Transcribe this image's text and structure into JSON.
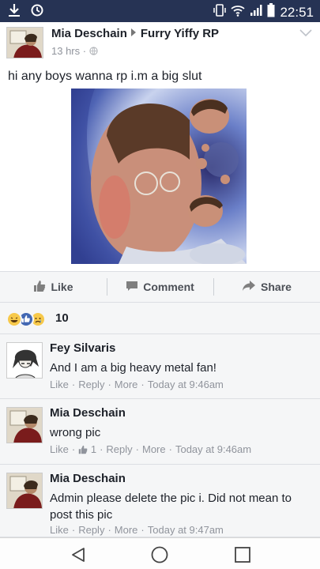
{
  "status_bar": {
    "time": "22:51",
    "left_icons": [
      "download-icon",
      "sync-icon"
    ],
    "right_icons": [
      "vibrate-icon",
      "wifi-icon",
      "signal-icon",
      "battery-icon"
    ]
  },
  "post": {
    "author": "Mia Deschain",
    "group": "Furry Yiffy RP",
    "time": "13 hrs",
    "privacy_icon": "globe-icon",
    "text": "hi any boys wanna rp i.m a big slut",
    "image_icon": "photo-image"
  },
  "actions": {
    "like": "Like",
    "comment": "Comment",
    "share": "Share"
  },
  "reactions": {
    "icons": [
      "haha-icon",
      "like-icon",
      "sad-icon"
    ],
    "count": "10"
  },
  "comments": [
    {
      "name": "Fey Silvaris",
      "text": "And I am a big heavy metal fan!",
      "like": "Like",
      "reply": "Reply",
      "more": "More",
      "time": "Today at 9:46am"
    },
    {
      "name": "Mia Deschain",
      "text": "wrong pic",
      "like": "Like",
      "like_count": "1",
      "reply": "Reply",
      "more": "More",
      "time": "Today at 9:46am"
    },
    {
      "name": "Mia Deschain",
      "text": "Admin please delete the pic i. Did not mean to post this pic",
      "like": "Like",
      "reply": "Reply",
      "more": "More",
      "time": "Today at 9:47am"
    }
  ],
  "nav": {
    "icons": [
      "back-icon",
      "home-icon",
      "recents-icon"
    ]
  },
  "colors": {
    "status_bar": "#263354",
    "background": "#e9ebee",
    "like_blue": "#4267b2",
    "meta_gray": "#90949c"
  }
}
